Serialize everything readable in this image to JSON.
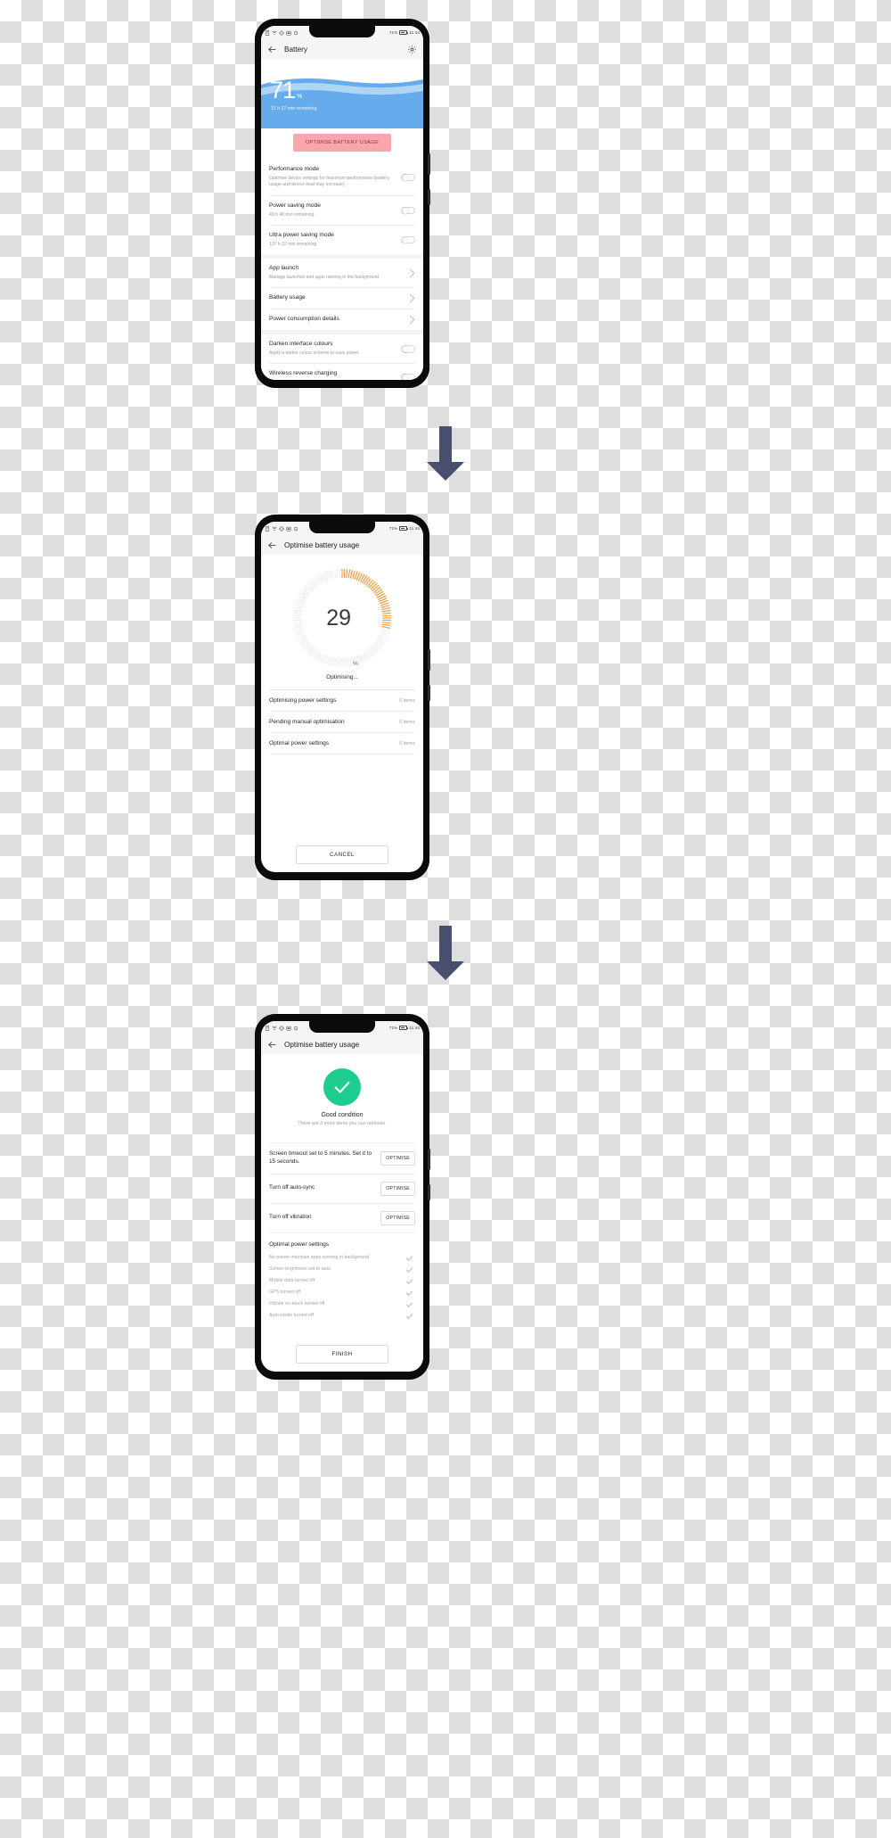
{
  "statusbar": {
    "icons": [
      "document-icon",
      "wifi-icon",
      "vibrate-icon",
      "calendar-icon",
      "g-network-icon"
    ],
    "battery_percent": "71%",
    "time": "11:44"
  },
  "arrows": {
    "name": "down-arrow",
    "color": "#494f6e",
    "count": 2
  },
  "screen1": {
    "appbar": {
      "back": "back-arrow-icon",
      "title": "Battery",
      "settings": "gear-icon"
    },
    "hero": {
      "percent_number": "71",
      "percent_symbol": "%",
      "remaining": "31 h 37 min remaining",
      "fill_color": "#66abec",
      "wave_color": "#bcdcf7"
    },
    "optimise_button": {
      "label": "OPTIMISE BATTERY USAGE",
      "bg": "#f8a6ae",
      "fg": "#9c2a3c"
    },
    "rows": [
      {
        "label": "Performance mode",
        "sub": "Optimise device settings for maximum performance (battery usage and device heat may increase)",
        "control": "toggle",
        "state": "off"
      },
      {
        "label": "Power saving mode",
        "sub": "49 h 48 min remaining",
        "control": "toggle",
        "state": "off"
      },
      {
        "label": "Ultra power saving mode",
        "sub": "137 h 22 min remaining",
        "control": "toggle",
        "state": "off"
      },
      {
        "label": "App launch",
        "sub": "Manage launches and apps running in the background",
        "control": "chevron"
      },
      {
        "label": "Battery usage",
        "sub": "",
        "control": "chevron"
      },
      {
        "label": "Power consumption details",
        "sub": "",
        "control": "chevron"
      },
      {
        "label": "Darken interface colours",
        "sub": "Apply a darker colour scheme to save power",
        "control": "toggle",
        "state": "off"
      },
      {
        "label": "Wireless reverse charging",
        "sub": "",
        "control": "toggle",
        "state": "off"
      }
    ]
  },
  "screen2": {
    "appbar": {
      "back": "back-arrow-icon",
      "title": "Optimise battery usage"
    },
    "dial": {
      "value": "29",
      "symbol": "%",
      "status": "Optimising...",
      "progress_percent": 29,
      "active_color": "#f0922b",
      "track_color": "#ececec"
    },
    "items": [
      {
        "label": "Optimising power settings",
        "value": "0 items"
      },
      {
        "label": "Pending manual optimisation",
        "value": "0 items"
      },
      {
        "label": "Optimal power settings",
        "value": "0 items"
      }
    ],
    "cancel_button": "CANCEL"
  },
  "screen3": {
    "appbar": {
      "back": "back-arrow-icon",
      "title": "Optimise battery usage"
    },
    "result": {
      "icon": "check-circle-icon",
      "icon_color": "#1dcd8e",
      "title": "Good condition",
      "subtitle": "There are 3 more items you can optimise."
    },
    "suggestions": [
      {
        "text": "Screen timeout set to 5 minutes. Set it to 15 seconds.",
        "action": "OPTIMISE"
      },
      {
        "text": "Turn off auto-sync",
        "action": "OPTIMISE"
      },
      {
        "text": "Turn off vibration",
        "action": "OPTIMISE"
      }
    ],
    "optimal": {
      "title": "Optimal power settings",
      "items": [
        "No power-intensive apps running in background",
        "Screen brightness set to auto",
        "Mobile data turned off",
        "GPS turned off",
        "Vibrate on touch turned off",
        "Auto-rotate turned off"
      ]
    },
    "finish_button": "FINISH"
  }
}
